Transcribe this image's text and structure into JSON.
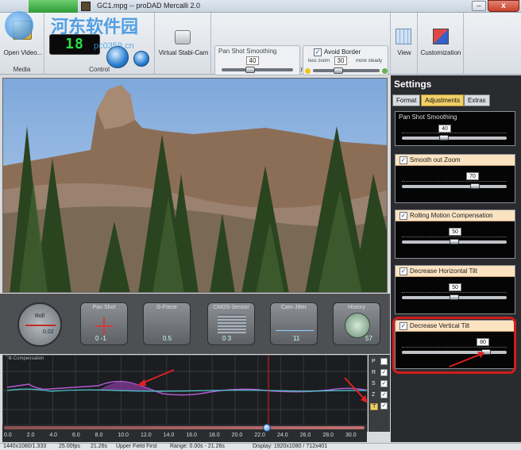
{
  "window": {
    "title": "GC1.mpg -- proDAD Mercalli 2.0",
    "close_label": "x",
    "min_label": "–"
  },
  "ribbon": {
    "media": {
      "open_label": "Open Video...",
      "group_label": "Media"
    },
    "control": {
      "timecode": "18",
      "group_label": "Control"
    },
    "stabicam": {
      "label": "Virtual Stabi-Cam"
    },
    "adjustments": {
      "group_label": "Adjustments",
      "pan_shot": {
        "label": "Pan Shot Smoothing",
        "value": "40",
        "level_pct": 40
      },
      "avoid_border": {
        "label": "Avoid Border",
        "checked": "✓",
        "left": "less zoom",
        "right": "more steady",
        "value": "30",
        "level_pct": 30
      }
    },
    "view": {
      "label": "View"
    },
    "customization": {
      "label": "Customization"
    }
  },
  "instruments": [
    {
      "label": "Roll",
      "value": "0.02"
    },
    {
      "label": "Pan Shot",
      "value": "0      -1"
    },
    {
      "label": "G-Force",
      "value": "0.5"
    },
    {
      "label": "CMOS-Sensor",
      "value": "0      3"
    },
    {
      "label": "Cam-Jitter",
      "value": "11"
    },
    {
      "label": "History",
      "value": "57"
    }
  ],
  "graph": {
    "title": "Tilt-Compensation",
    "legend": [
      {
        "key": "P",
        "checked": ""
      },
      {
        "key": "R",
        "checked": "✓"
      },
      {
        "key": "S",
        "checked": "✓"
      },
      {
        "key": "Z",
        "checked": "✓"
      },
      {
        "key": "T",
        "checked": "✓"
      }
    ],
    "ticks": [
      "0.0",
      "2.0",
      "4.0",
      "6.0",
      "8.0",
      "10.0",
      "12.0",
      "14.0",
      "16.0",
      "18.0",
      "20.0",
      "22.0",
      "24.0",
      "26.0",
      "28.0",
      "30.0"
    ],
    "playhead_pct": 73,
    "cursor_sec": 22.5
  },
  "status": {
    "resolution": "1440x1080/1.333",
    "fps": "25.00fps",
    "duration": "21.26s",
    "field": "Upper Field First",
    "range": "Range: 0.00s - 21.26s",
    "display": "Display: 1920x1080 / 712x401"
  },
  "settings": {
    "title": "Settings",
    "tabs": [
      "Format",
      "Adjustments",
      "Extras"
    ],
    "panels": [
      {
        "label": "Pan Shot Smoothing",
        "value": "40",
        "level_pct": 40,
        "checkable": false
      },
      {
        "label": "Smooth out Zoom",
        "value": "70",
        "level_pct": 70,
        "checkable": true,
        "checked": "✓"
      },
      {
        "label": "Rolling Motion Compensation",
        "value": "50",
        "level_pct": 50,
        "checkable": true,
        "checked": "✓"
      },
      {
        "label": "Decrease Horizontal Tilt",
        "value": "50",
        "level_pct": 50,
        "checkable": true,
        "checked": "✓"
      },
      {
        "label": "Decrease Vertical Tilt",
        "value": "80",
        "level_pct": 80,
        "checkable": true,
        "checked": "✓"
      }
    ]
  },
  "watermark": {
    "text": "河东软件园",
    "url": "pc0359.cn"
  },
  "colors": {
    "accent": "#f2d069",
    "highlight": "#d21d1d",
    "lcd": "#27e24a"
  }
}
